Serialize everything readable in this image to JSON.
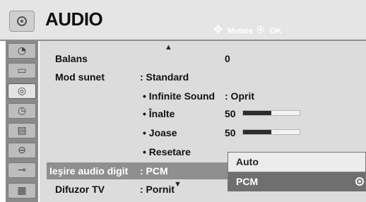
{
  "header": {
    "title": "AUDIO",
    "hint_move": "Mutare",
    "hint_ok": "OK",
    "icon": "speaker-icon"
  },
  "sidebar": {
    "items": [
      {
        "icon": "satellite-dish-icon"
      },
      {
        "icon": "tv-screen-icon"
      },
      {
        "icon": "speaker-icon",
        "active": true
      },
      {
        "icon": "clock-icon"
      },
      {
        "icon": "lock-grid-icon"
      },
      {
        "icon": "padlock-icon"
      },
      {
        "icon": "input-plug-icon"
      },
      {
        "icon": "usb-icon"
      }
    ]
  },
  "menu": {
    "balans": {
      "label": "Balans",
      "value": "0"
    },
    "mod_sunet": {
      "label": "Mod sunet",
      "value": ": Standard"
    },
    "infinite_sound": {
      "label": "• Infinite Sound",
      "value": ": Oprit"
    },
    "inalte": {
      "label": "• Înalte",
      "value": "50",
      "level": 50
    },
    "joase": {
      "label": "• Joase",
      "value": "50",
      "level": 50
    },
    "resetare": {
      "label": "• Resetare"
    },
    "iesire_audio": {
      "label": "Ieşire audio digit",
      "value": ": PCM",
      "selected": true
    },
    "difuzor_tv": {
      "label": "Difuzor TV",
      "value": ": Pornit"
    }
  },
  "popup": {
    "options": [
      "Auto",
      "PCM"
    ],
    "selected": "PCM"
  },
  "colors": {
    "header_bg": "#e5e5e5",
    "content_bg": "#dcdcdc",
    "sidebar_bg": "#8a8a8a",
    "selected_row": "#8f8f8f",
    "popup_selected": "#6f6f6f"
  }
}
